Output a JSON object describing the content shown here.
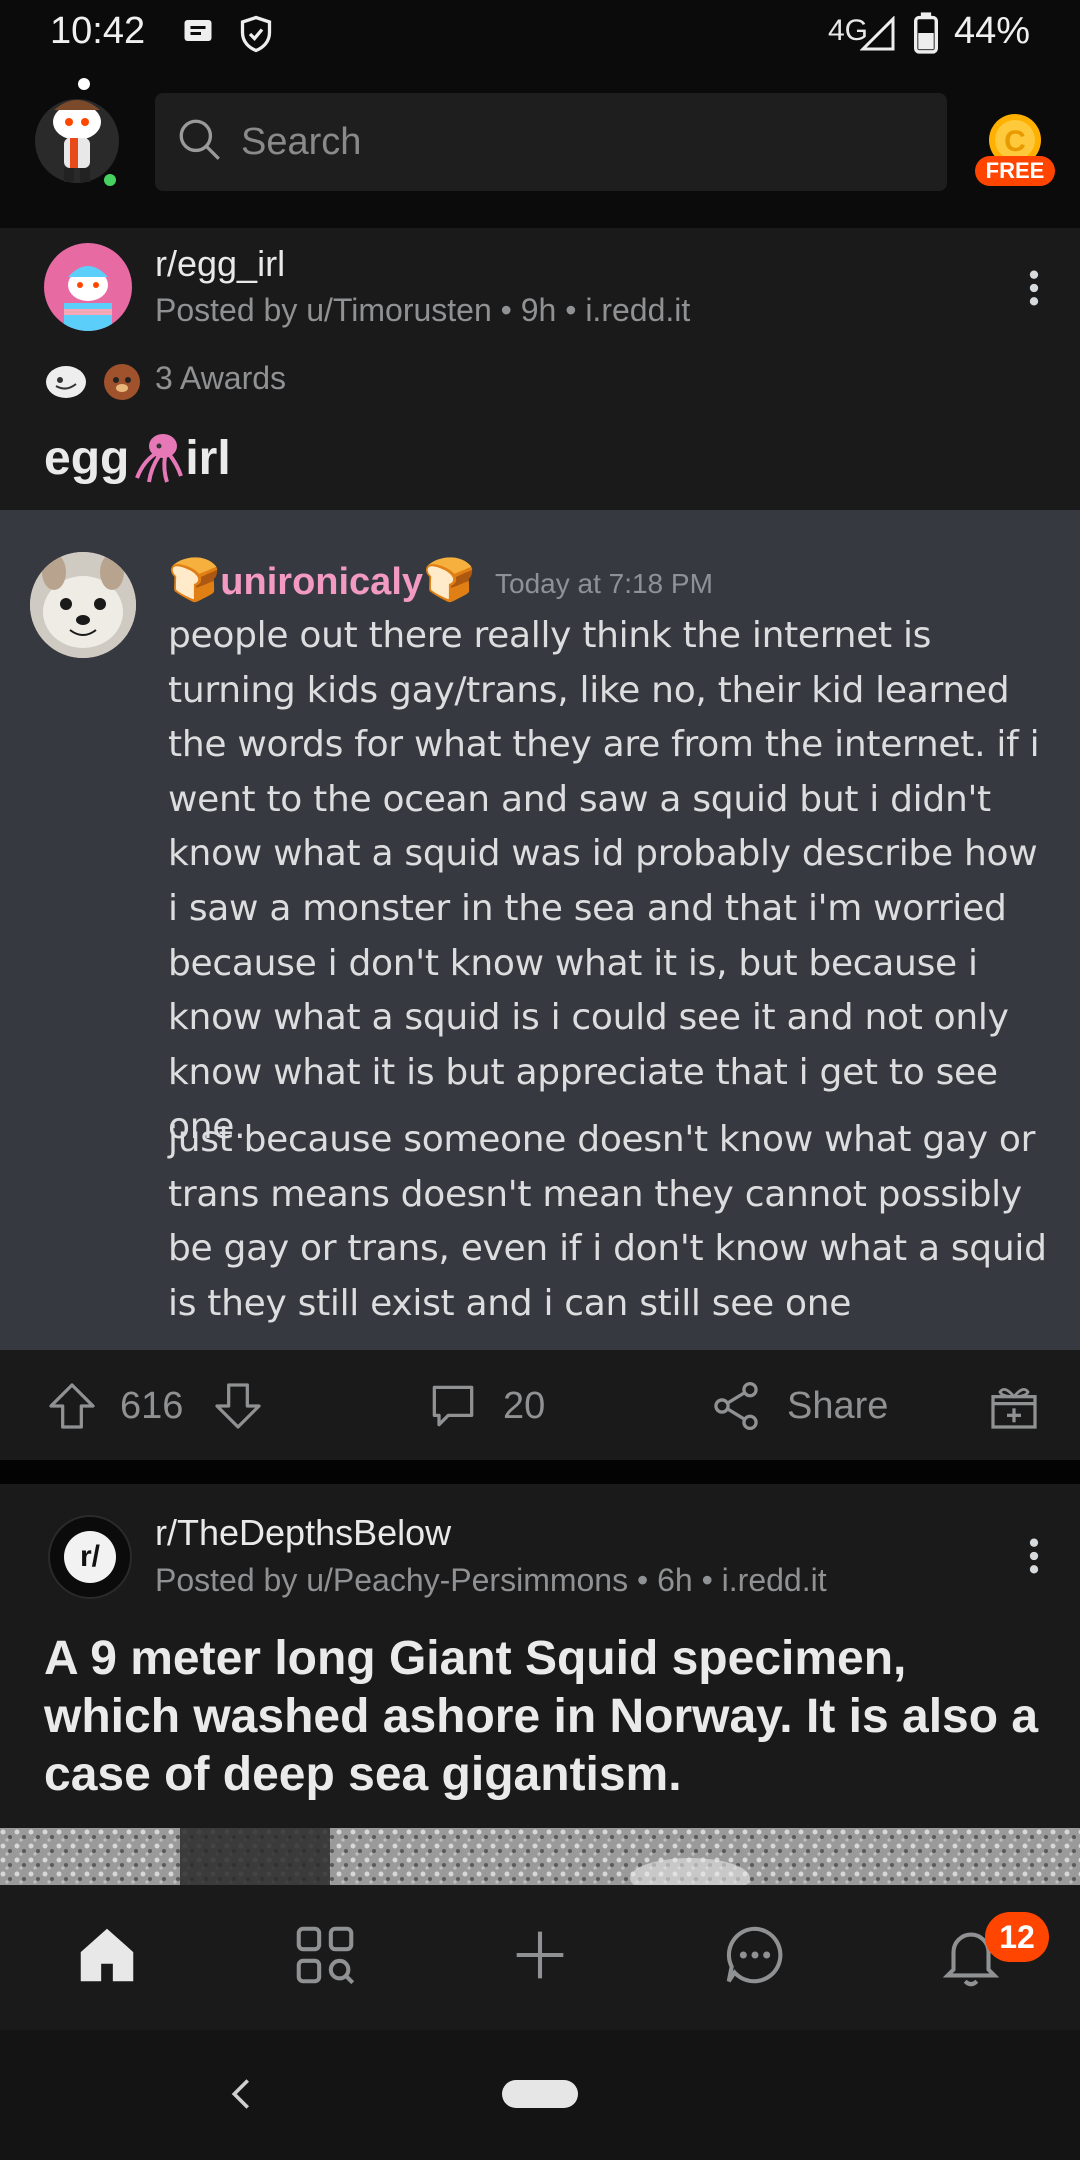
{
  "status_bar": {
    "time": "10:42",
    "network": "4G",
    "battery": "44%",
    "icons": [
      "message-icon",
      "shield-check-icon",
      "signal-icon",
      "battery-icon"
    ]
  },
  "header": {
    "search_placeholder": "Search",
    "coin_badge": "FREE"
  },
  "post1": {
    "subreddit": "r/egg_irl",
    "posted_by": "Posted by u/Timorusten • 9h • i.redd.it",
    "awards": "3 Awards",
    "title_left": "egg",
    "title_right": "irl",
    "votes": "616",
    "comments": "20",
    "share": "Share",
    "image": {
      "username": "unironicaly",
      "timestamp": "Today at 7:18 PM",
      "message1": "people out there really think the internet is turning kids gay/trans, like no, their kid learned the words for what they are from the internet. if i went to the ocean and saw a squid but i didn't know what a squid was id probably describe how i saw a monster in the sea and that i'm worried because i don't know what it is, but because i know what a squid is i could see it and not only know what it is but appreciate that i get to see one.",
      "message2": "just because someone doesn't know what gay or trans means doesn't mean they cannot possibly be gay or trans, even if i don't know what a squid is they still exist and i can still see one"
    }
  },
  "post2": {
    "subreddit": "r/TheDepthsBelow",
    "posted_by": "Posted by u/Peachy-Persimmons • 6h • i.redd.it",
    "title": "A 9 meter long Giant Squid specimen, which washed ashore in Norway. It is also a case of deep sea gigantism.",
    "sub_icon_text": "r/"
  },
  "bottom_nav": {
    "notification_count": "12",
    "items": [
      "home-icon",
      "discover-icon",
      "create-post-icon",
      "chat-icon",
      "notifications-icon"
    ]
  },
  "colors": {
    "accent": "#ff4500",
    "username_pink": "#f29ac2",
    "discord_bg": "#36393f",
    "card_bg": "#1a1a1b"
  }
}
